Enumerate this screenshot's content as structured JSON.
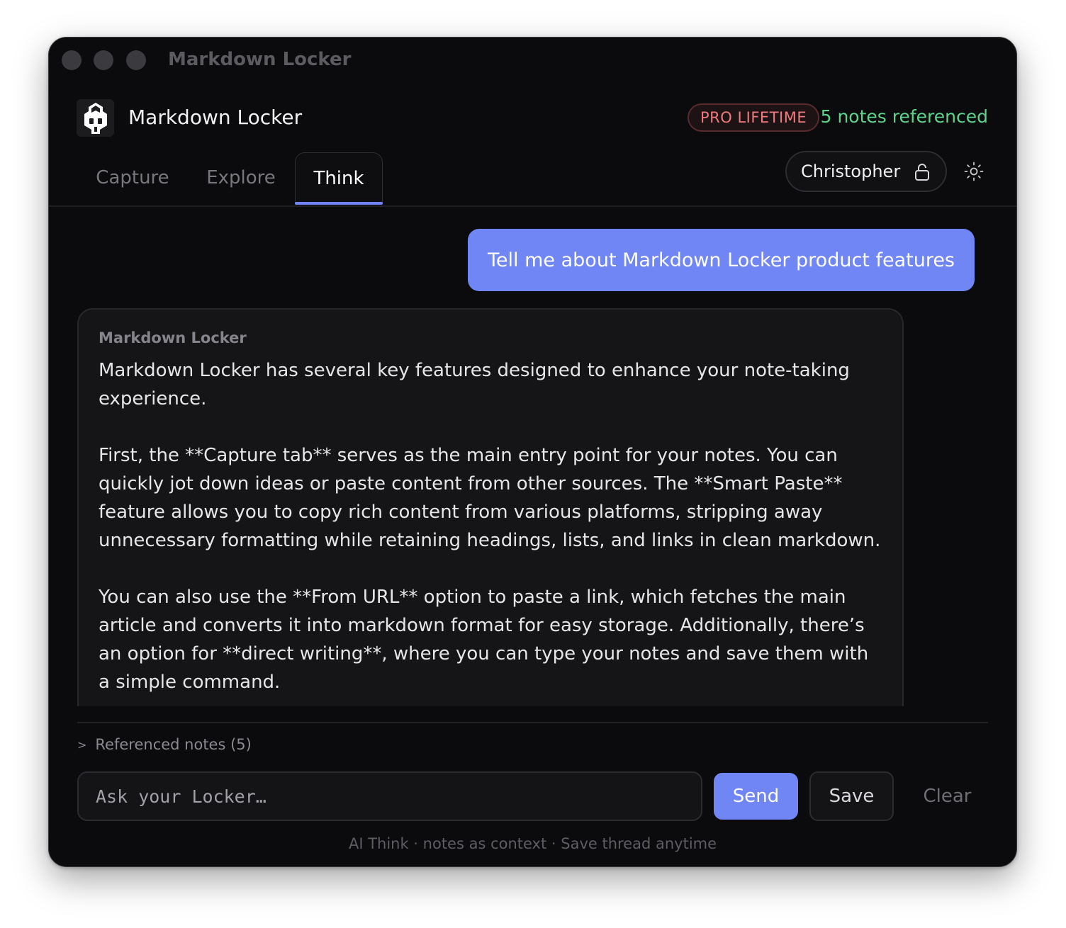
{
  "window": {
    "title": "Markdown Locker"
  },
  "header": {
    "app_name": "Markdown Locker",
    "plan_badge": "PRO LIFETIME",
    "notes_referenced": "5 notes referenced"
  },
  "tabs": [
    {
      "label": "Capture",
      "active": false
    },
    {
      "label": "Explore",
      "active": false
    },
    {
      "label": "Think",
      "active": true
    }
  ],
  "user": {
    "name": "Christopher",
    "lock_icon": "unlocked-lock-icon"
  },
  "theme_icon": "sun-icon",
  "chat": {
    "user_message": "Tell me about Markdown Locker product features",
    "assistant": {
      "name": "Markdown Locker",
      "paragraphs": [
        "Markdown Locker has several key features designed to enhance your note-taking experience.",
        "First, the **Capture tab** serves as the main entry point for your notes. You can quickly jot down ideas or paste content from other sources. The **Smart Paste** feature allows you to copy rich content from various platforms, stripping away unnecessary formatting while retaining headings, lists, and links in clean markdown.",
        "You can also use the **From URL** option to paste a link, which fetches the main article and converts it into markdown format for easy storage. Additionally, there’s an option for **direct writing**, where you can type your notes and save them with a simple command."
      ]
    }
  },
  "referenced_notes": {
    "toggle_icon": ">",
    "label": "Referenced notes (5)"
  },
  "composer": {
    "placeholder": "Ask your Locker…",
    "value": "",
    "send_label": "Send",
    "save_label": "Save",
    "clear_label": "Clear"
  },
  "footer": "AI Think · notes as context · Save thread anytime",
  "colors": {
    "accent": "#7086f4",
    "success": "#5fd38d",
    "badge": "#ef7a7e",
    "background": "#0b0b0d"
  }
}
